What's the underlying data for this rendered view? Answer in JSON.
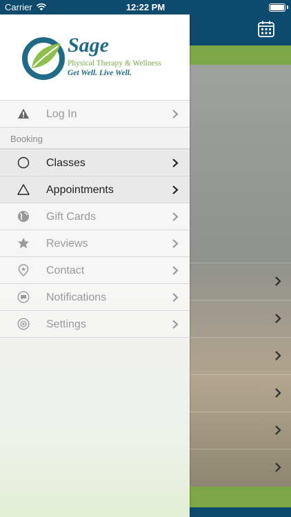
{
  "status_bar": {
    "carrier": "Carrier",
    "time": "12:22 PM"
  },
  "brand": {
    "name": "Sage",
    "subtitle": "Physical Therapy & Wellness",
    "tagline": "Get Well. Live Well."
  },
  "menu": {
    "login": "Log In",
    "section_booking": "Booking",
    "items": [
      {
        "label": "Classes",
        "icon": "circle-icon"
      },
      {
        "label": "Appointments",
        "icon": "triangle-icon"
      },
      {
        "label": "Gift Cards",
        "icon": "globe-icon"
      },
      {
        "label": "Reviews",
        "icon": "star-icon"
      },
      {
        "label": "Contact",
        "icon": "location-pin-icon"
      },
      {
        "label": "Notifications",
        "icon": "chat-bubble-icon"
      },
      {
        "label": "Settings",
        "icon": "gear-icon"
      }
    ]
  },
  "colors": {
    "nav_blue": "#0e4a6e",
    "accent_green": "#7ca746",
    "brand_teal": "#1f6b87"
  }
}
